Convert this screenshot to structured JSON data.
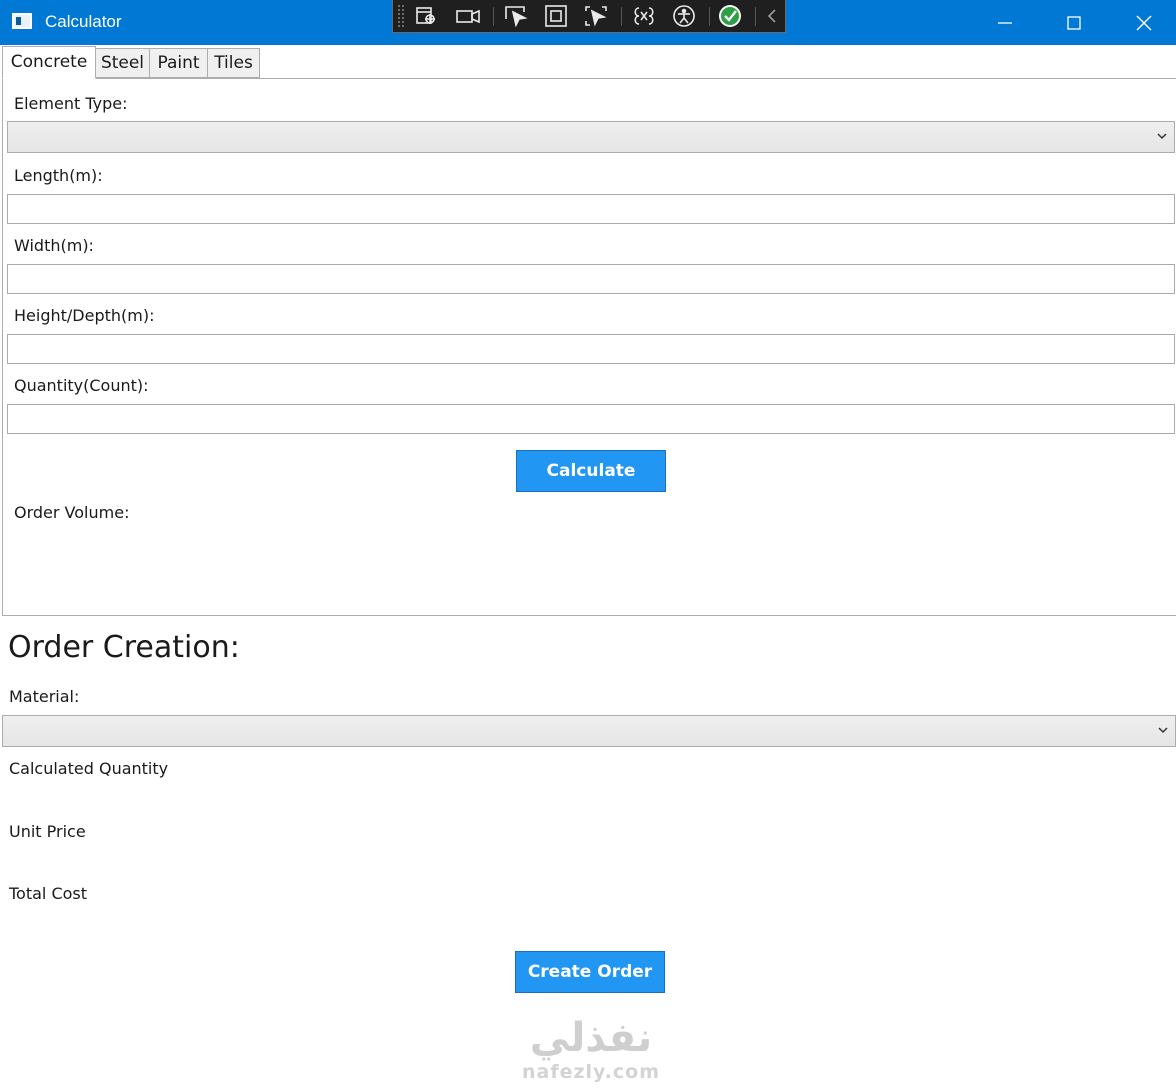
{
  "window": {
    "title": "Calculator"
  },
  "tabs": [
    {
      "label": "Concrete",
      "active": true
    },
    {
      "label": "Steel",
      "active": false
    },
    {
      "label": "Paint",
      "active": false
    },
    {
      "label": "Tiles",
      "active": false
    }
  ],
  "concrete": {
    "element_type_label": "Element Type:",
    "element_type_value": "",
    "length_label": "Length(m):",
    "length_value": "",
    "width_label": "Width(m):",
    "width_value": "",
    "height_label": "Height/Depth(m):",
    "height_value": "",
    "quantity_label": "Quantity(Count):",
    "quantity_value": "",
    "calculate_label": "Calculate",
    "order_volume_label": "Order Volume:"
  },
  "order": {
    "heading": "Order Creation:",
    "material_label": "Material:",
    "material_value": "",
    "calculated_quantity_label": "Calculated Quantity",
    "unit_price_label": "Unit Price",
    "total_cost_label": "Total Cost",
    "create_order_label": "Create Order"
  },
  "watermark": {
    "arabic": "نفذلي",
    "latin": "nafezly.com"
  },
  "colors": {
    "titlebar": "#0078d4",
    "button": "#2196f3",
    "devbar": "#1f1f1f",
    "check_green": "#2ea043"
  }
}
